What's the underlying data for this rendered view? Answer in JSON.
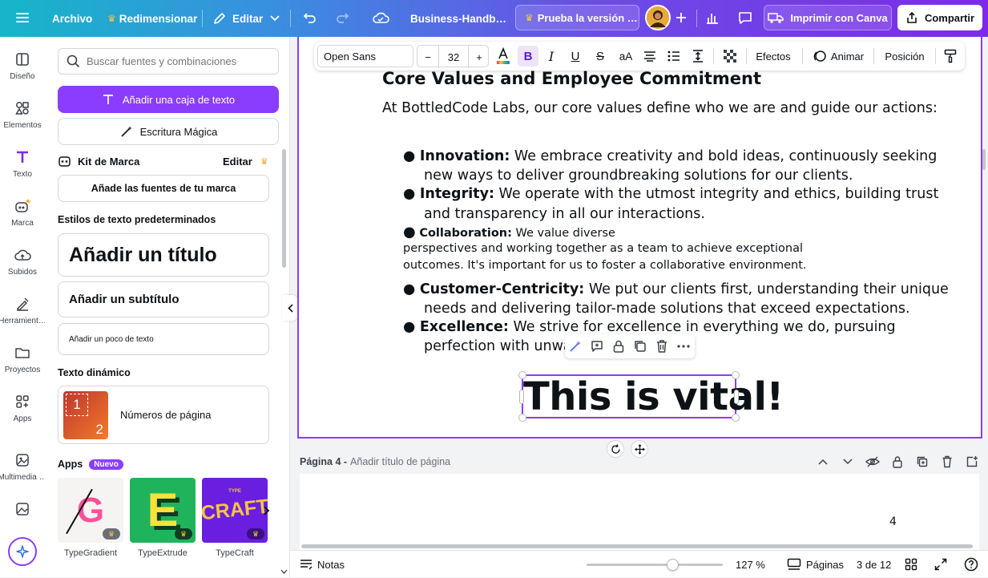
{
  "topbar": {
    "menu_icon": "hamburger-icon",
    "file_label": "Archivo",
    "resize_label": "Redimensionar",
    "edit_label": "Editar",
    "doc_title": "Business-Handb…",
    "trial_label": "Prueba la versión …",
    "print_label": "Imprimir con Canva",
    "share_label": "Compartir"
  },
  "rail": [
    {
      "label": "Diseño",
      "icon": "layout-icon"
    },
    {
      "label": "Elementos",
      "icon": "shapes-icon"
    },
    {
      "label": "Texto",
      "icon": "text-icon"
    },
    {
      "label": "Marca",
      "icon": "brand-icon"
    },
    {
      "label": "Subidos",
      "icon": "cloud-upload-icon"
    },
    {
      "label": "Herramient…",
      "icon": "tools-icon"
    },
    {
      "label": "Proyectos",
      "icon": "folder-icon"
    },
    {
      "label": "Apps",
      "icon": "apps-icon"
    },
    {
      "label": "Multimedia …",
      "icon": "media-icon"
    }
  ],
  "panel": {
    "search_placeholder": "Buscar fuentes y combinaciones",
    "add_textbox": "Añadir una caja de texto",
    "magic_write": "Escritura Mágica",
    "brand_kit": "Kit de Marca",
    "brand_edit": "Editar",
    "add_brand_fonts": "Añade las fuentes de tu marca",
    "default_styles": "Estilos de texto predeterminados",
    "add_title": "Añadir un título",
    "add_subtitle": "Añadir un subtítulo",
    "add_body": "Añadir un poco de texto",
    "dynamic_text": "Texto dinámico",
    "page_numbers": "Números de página",
    "page_numbers_thumb_1": "1",
    "page_numbers_thumb_2": "2",
    "apps_title": "Apps",
    "new_badge": "Nuevo",
    "apps": [
      {
        "name": "TypeGradient",
        "thumb": "G"
      },
      {
        "name": "TypeExtrude",
        "thumb": "E"
      },
      {
        "name": "TypeCraft",
        "thumb": "CRAFT",
        "thumb_small": "TYPE"
      }
    ]
  },
  "format_bar": {
    "font": "Open Sans",
    "size": "32",
    "minus": "−",
    "plus": "+",
    "effects": "Efectos",
    "animate": "Animar",
    "position": "Posición",
    "case_label": "aA"
  },
  "document": {
    "heading": "Core Values and Employee Commitment",
    "intro": "At BottledCode Labs, our core values define who we are and guide our actions:",
    "bullets": [
      {
        "term": "Innovation:",
        "line1": " We embrace creativity and bold ideas, continuously seeking",
        "line2": "new ways to deliver groundbreaking solutions for our clients."
      },
      {
        "term": "Integrity:",
        "line1": " We operate with the utmost integrity and ethics, building trust",
        "line2": "and transparency in all our interactions."
      },
      {
        "term": "Collaboration:",
        "line1": " We value diverse",
        "line2": "perspectives and working together as a team to achieve exceptional",
        "line3": "outcomes. It's important for us to foster a collaborative environment."
      },
      {
        "term": "Customer-Centricity:",
        "line1": " We put our clients first, understanding their unique",
        "line2": "needs and delivering tailor-made solutions that exceed expectations."
      },
      {
        "term": "Excellence:",
        "line1": " We strive for excellence in everything we do, pursuing",
        "line2": "perfection with unwave"
      }
    ],
    "selected_text": "This is vital!"
  },
  "page_strip": {
    "page_label": "Página 4 -",
    "title_placeholder": "Añadir título de página",
    "page_number": "4"
  },
  "bottom_bar": {
    "notes": "Notas",
    "zoom": "127 %",
    "zoom_fraction": 0.63,
    "pages": "Páginas",
    "page_count": "3 de 12"
  },
  "colors": {
    "accent": "#8b3dff",
    "gold": "#f5a623"
  }
}
